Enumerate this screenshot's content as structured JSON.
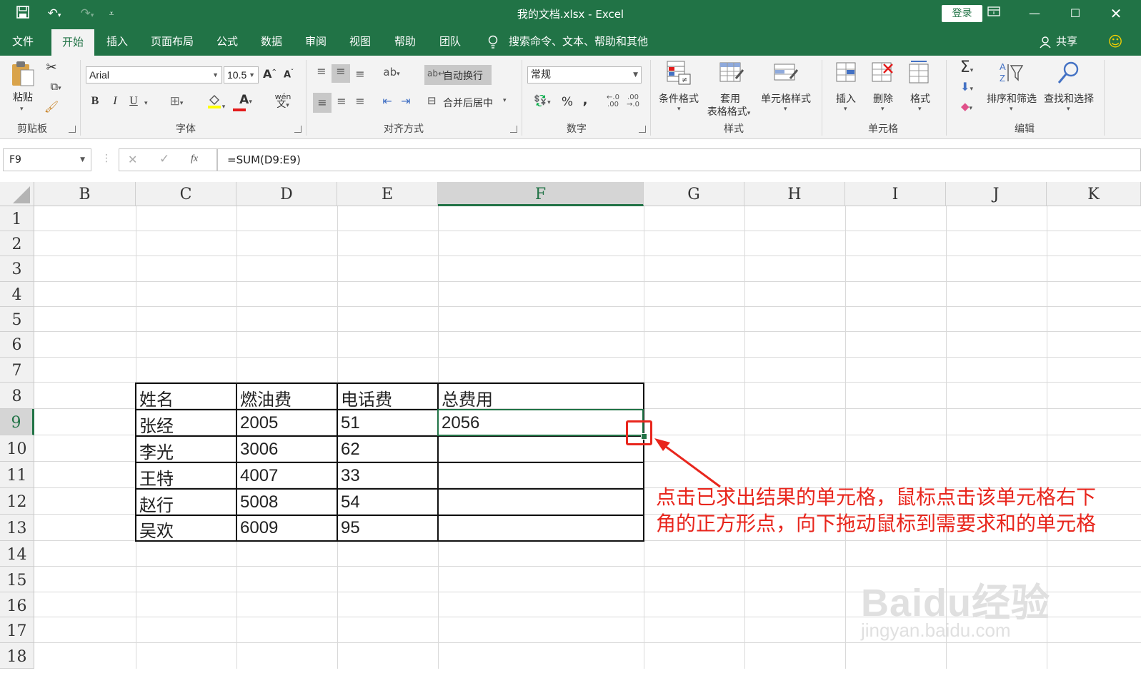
{
  "titlebar": {
    "doc_title": "我的文档.xlsx  -  Excel",
    "login": "登录"
  },
  "tabs": [
    "文件",
    "开始",
    "插入",
    "页面布局",
    "公式",
    "数据",
    "审阅",
    "视图",
    "帮助",
    "团队"
  ],
  "active_tab": "开始",
  "tell_me": "搜索命令、文本、帮助和其他",
  "share": "共享",
  "ribbon": {
    "clipboard": {
      "paste": "粘贴",
      "group": "剪贴板"
    },
    "font": {
      "name": "Arial",
      "size": "10.5",
      "bold": "B",
      "italic": "I",
      "underline": "U",
      "group": "字体"
    },
    "alignment": {
      "wrap": "自动换行",
      "merge": "合并后居中",
      "group": "对齐方式"
    },
    "number": {
      "format": "常规",
      "percent": "%",
      "comma": ",",
      "group": "数字"
    },
    "styles": {
      "conditional": "条件格式",
      "table_format_1": "套用",
      "table_format_2": "表格格式",
      "cell_styles": "单元格样式",
      "group": "样式"
    },
    "cells": {
      "insert": "插入",
      "delete": "删除",
      "format": "格式",
      "group": "单元格"
    },
    "editing": {
      "sort": "排序和筛选",
      "find": "查找和选择",
      "group": "编辑"
    }
  },
  "formula_bar": {
    "name_box": "F9",
    "fx": "fx",
    "formula": "=SUM(D9:E9)"
  },
  "columns": [
    "B",
    "C",
    "D",
    "E",
    "F",
    "G",
    "H",
    "I",
    "J",
    "K"
  ],
  "selected_column": "F",
  "rows": [
    "1",
    "2",
    "3",
    "4",
    "5",
    "6",
    "7",
    "8",
    "9",
    "10",
    "11",
    "12",
    "13",
    "14",
    "15",
    "16",
    "17",
    "18"
  ],
  "selected_row": "9",
  "table": {
    "headers": [
      "姓名",
      "燃油费",
      "电话费",
      "总费用"
    ],
    "rows": [
      [
        "张经",
        "2005",
        "51",
        "2056"
      ],
      [
        "李光",
        "3006",
        "62",
        ""
      ],
      [
        "王特",
        "4007",
        "33",
        ""
      ],
      [
        "赵行",
        "5008",
        "54",
        ""
      ],
      [
        "吴欢",
        "6009",
        "95",
        ""
      ]
    ]
  },
  "annotation": {
    "text": "点击已求出结果的单元格，鼠标点击该单元格右下角的正方形点，向下拖动鼠标到需要求和的单元格",
    "color": "#e8261d"
  },
  "watermark": {
    "logo": "Baidu经验",
    "url": "jingyan.baidu.com"
  },
  "colors": {
    "accent": "#217346"
  }
}
